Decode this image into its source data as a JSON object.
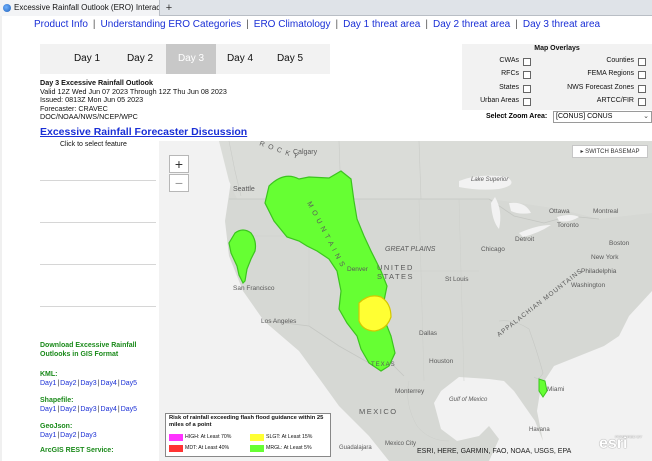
{
  "browser": {
    "tab_title": "Excessive Rainfall Outlook (ERO) Interact...",
    "new_tab": "+"
  },
  "top_links": [
    "Product Info",
    "Understanding ERO Categories",
    "ERO Climatology",
    "Day 1 threat area",
    "Day 2 threat area",
    "Day 3 threat area"
  ],
  "day_tabs": [
    "Day 1",
    "Day 2",
    "Day 3",
    "Day 4",
    "Day 5"
  ],
  "active_day": "Day 3",
  "outlook": {
    "title": "Day 3 Excessive Rainfall Outlook",
    "valid": "Valid 12Z Wed Jun 07 2023 Through 12Z Thu Jun 08 2023",
    "issued": "Issued: 0813Z Mon Jun 05 2023",
    "forecaster": "Forecaster: CRAVEC",
    "office": "DOC/NOAA/NWS/NCEP/WPC",
    "discussion_link": "Excessive Rainfall Forecaster Discussion",
    "select_hint": "Click to select feature"
  },
  "gis": {
    "title": "Download Excessive Rainfall Outlooks in GIS Format",
    "kml_label": "KML:",
    "kml_links": [
      "Day1",
      "Day2",
      "Day3",
      "Day4",
      "Day5"
    ],
    "shapefile_label": "Shapefile:",
    "shapefile_links": [
      "Day1",
      "Day2",
      "Day3",
      "Day4",
      "Day5"
    ],
    "geojson_label": "GeoJson:",
    "geojson_links": [
      "Day1",
      "Day2",
      "Day3"
    ],
    "rest_label": "ArcGIS REST Service:"
  },
  "overlays": {
    "title": "Map Overlays",
    "items": [
      "CWAs",
      "Counties",
      "RFCs",
      "FEMA Regions",
      "States",
      "NWS Forecast Zones",
      "Urban Areas",
      "ARTCC/FIR"
    ],
    "zoom_label": "Select Zoom Area:",
    "zoom_value": "[CONUS] CONUS"
  },
  "map": {
    "zoom_in": "+",
    "zoom_out": "−",
    "switch_basemap": "▸ SWITCH BASEMAP",
    "attribution": "ESRI, HERE, GARMIN, FAO, NOAA, USGS, EPA",
    "esri_logo": "esri",
    "powered_by": "POWERED BY",
    "labels": {
      "calgary": "Calgary",
      "seattle": "Seattle",
      "san_francisco": "San Francisco",
      "los_angeles": "Los Angeles",
      "denver": "Denver",
      "united": "UNITED",
      "states": "STATES",
      "great_plains": "GREAT PLAINS",
      "chicago": "Chicago",
      "detroit": "Detroit",
      "toronto": "Toronto",
      "ottawa": "Ottawa",
      "montreal": "Montreal",
      "boston": "Boston",
      "new_york": "New York",
      "philadelphia": "Philadelphia",
      "washington": "Washington",
      "st_louis": "St Louis",
      "dallas": "Dallas",
      "houston": "Houston",
      "monterrey": "Monterrey",
      "mexico": "MEXICO",
      "miami": "Miami",
      "gulf": "Gulf of Mexico",
      "lake_superior": "Lake Superior",
      "rocky": "R O C K Y",
      "mountains": "M O U N T A I N S",
      "appalachian": "APPALACHIAN MOUNTAINS",
      "texas": "TEXAS",
      "havana": "Havana",
      "guadalajara": "Guadalajara",
      "mexico_city": "Mexico City"
    }
  },
  "legend": {
    "title": "Risk of rainfall exceeding flash flood guidance within 25 miles of a point",
    "items": [
      {
        "label": "HIGH: At Least 70%",
        "color": "#ff33ff"
      },
      {
        "label": "SLGT: At Least 15%",
        "color": "#ffff33"
      },
      {
        "label": "MDT: At Least 40%",
        "color": "#ff3333"
      },
      {
        "label": "MRGL: At Least 5%",
        "color": "#66ff33"
      }
    ]
  },
  "colors": {
    "link": "#1a2fd6",
    "gis_heading": "#1a8a1a",
    "marginal": "#66ff33",
    "slight": "#ffff33",
    "land": "#d4d6d2",
    "water": "#f2f2f2"
  }
}
